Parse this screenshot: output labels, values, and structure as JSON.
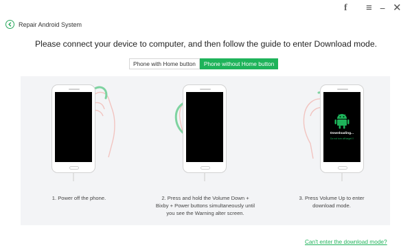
{
  "titlebar": {
    "facebook_glyph": "f",
    "menu_glyph": "≡",
    "minimize_glyph": "−",
    "close_glyph": "✕"
  },
  "back": {
    "label": "Repair Android System"
  },
  "heading": "Please connect your device to computer, and then follow the guide to enter Download mode.",
  "tabs": [
    {
      "label": "Phone with Home button",
      "active": false
    },
    {
      "label": "Phone without Home button",
      "active": true
    }
  ],
  "steps": [
    {
      "lines": [
        "1. Power off the phone."
      ]
    },
    {
      "lines": [
        "2. Press and hold the Volume Down +",
        "Bixby + Power buttons simultaneously until",
        "you see the Warning alter screen."
      ]
    },
    {
      "lines": [
        "3. Press Volume Up to enter",
        "download mode."
      ]
    }
  ],
  "download_screen": {
    "title": "Downloading...",
    "subtitle": "Do not turn off target !!"
  },
  "footer_link": "Can't enter the download mode?",
  "colors": {
    "accent": "#1eb35a",
    "panel": "#f3f4f6",
    "hand_outline": "#f2c4c0"
  },
  "icons": [
    "facebook-icon",
    "menu-icon",
    "minimize-icon",
    "close-icon",
    "back-arrow-icon",
    "android-icon",
    "hand-icon"
  ]
}
